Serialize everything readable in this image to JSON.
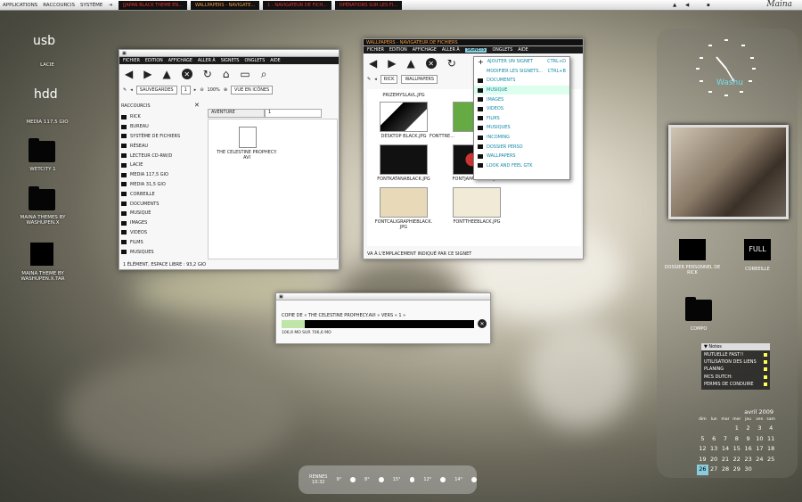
{
  "topbar": {
    "applications": "APPLICATIONS",
    "raccourcis": "RACCOURCIS",
    "systeme": "SYSTÈME",
    "tasks": [
      "[JAPAN BLACK THEME EN...",
      "WALLPAPERS - NAVIGATE...",
      "1 - NAVIGATEUR DE FICH...",
      "OPÉRATIONS SUR LES FI..."
    ],
    "brand": "Maina"
  },
  "desktop": {
    "usb": "usb",
    "lacie": "LACIE",
    "hdd": "hdd",
    "media": "MEDIA 117,5 GIO",
    "wetcity": "WETCITY 1",
    "mainatheme": "MAINA THEMES BY WASHUPEN.X",
    "mainatheme_tar": "MAINA THEME BY WASHUPEN.X.TAR"
  },
  "nautilus1": {
    "menu": [
      "FICHIER",
      "EDITION",
      "AFFICHAGE",
      "ALLER À",
      "SIGNETS",
      "ONGLETS",
      "AIDE"
    ],
    "sauvegardes": "SAUVEGARDES",
    "tab_num": "1",
    "zoom": "100%",
    "view": "VUE EN ICÔNES",
    "raccourcis": "RACCOURCIS",
    "tabs": [
      "AVENTURE",
      "1"
    ],
    "file": "THE CELESTINE PROPHECY. AVI",
    "status": "1 ÉLÉMENT, ESPACE LIBRE : 93,2 GIO",
    "sidebar": [
      "RICK",
      "BUREAU",
      "SYSTÈME DE FICHIERS",
      "RÉSEAU",
      "LECTEUR CD-RW/D",
      "LACIE",
      "MEDIA 117,5 GIO",
      "MEDIA 31,5 GIO",
      "CORBEILLE",
      "DOCUMENTS",
      "MUSIQUE",
      "IMAGES",
      "VIDEOS",
      "FILMS",
      "MUSIQUES"
    ]
  },
  "nautilus2": {
    "title": "WALLPAPERS - NAVIGATEUR DE FICHIERS",
    "menu": [
      "FICHIER",
      "EDITION",
      "AFFICHAGE",
      "ALLER À",
      "SIGNETS",
      "ONGLETS",
      "AIDE"
    ],
    "path": [
      "RICK",
      "WALLPAPERS"
    ],
    "top_file": "PRIZEMYSLAVL.JPG",
    "files": [
      "DESKTOP BLACK.JPG",
      "FONTTRE...",
      "FONTKATANABLACK.JPG",
      "FONTJAPANBLACK.JPG",
      "FONTCALIGRAPHIEBLACK. JPG",
      "FONTTHEEBLACK.JPG"
    ],
    "status": "VA À L'EMPLACEMENT INDIQUÉ PAR CE SIGNET"
  },
  "bookmarks": {
    "add": "AJOUTER UN SIGNET",
    "add_key": "CTRL+D",
    "edit": "MODIFIER LES SIGNETS...",
    "edit_key": "CTRL+B",
    "items": [
      "DOCUMENTS",
      "MUSIQUE",
      "IMAGES",
      "VIDEOS",
      "FILMS",
      "MUSIQUES",
      "INCOMING",
      "DOSSIER PERSO",
      "WALLPAPERS",
      "LOOK AND FEEL GTK"
    ]
  },
  "copy": {
    "text": "COPIE DE « THE CELESTINE PROPHECY.AVI » VERS « 1 »",
    "progress": 0.12,
    "status": "106,9 MO SUR 706,6 MO"
  },
  "right": {
    "clock_text": "Washu",
    "home": "DOSSIER PERSONNEL DE RICK",
    "corbeille": "CORBEILLE",
    "full": "FULL",
    "compo": "COMPO"
  },
  "notes": {
    "title": "▼ Notes",
    "items": [
      "MUTUELLE FAST!!",
      "UTILISATION DES LIENS",
      "PLANING",
      "MCS DUTCH:",
      "PERMIS DE CONDUIRE"
    ]
  },
  "calendar": {
    "month": "avril 2009",
    "days": [
      "dim",
      "lun",
      "mar",
      "mer",
      "jeu",
      "ven",
      "sam"
    ],
    "weeks": [
      [
        "",
        "",
        "",
        "1",
        "2",
        "3",
        "4"
      ],
      [
        "5",
        "6",
        "7",
        "8",
        "9",
        "10",
        "11"
      ],
      [
        "12",
        "13",
        "14",
        "15",
        "16",
        "17",
        "18"
      ],
      [
        "19",
        "20",
        "21",
        "22",
        "23",
        "24",
        "25"
      ],
      [
        "26",
        "27",
        "28",
        "29",
        "30",
        "",
        ""
      ]
    ]
  },
  "weather": {
    "city": "RENNES",
    "time": "10:32",
    "temps": [
      "9°",
      "8°",
      "15°",
      "12°",
      "14°"
    ]
  }
}
